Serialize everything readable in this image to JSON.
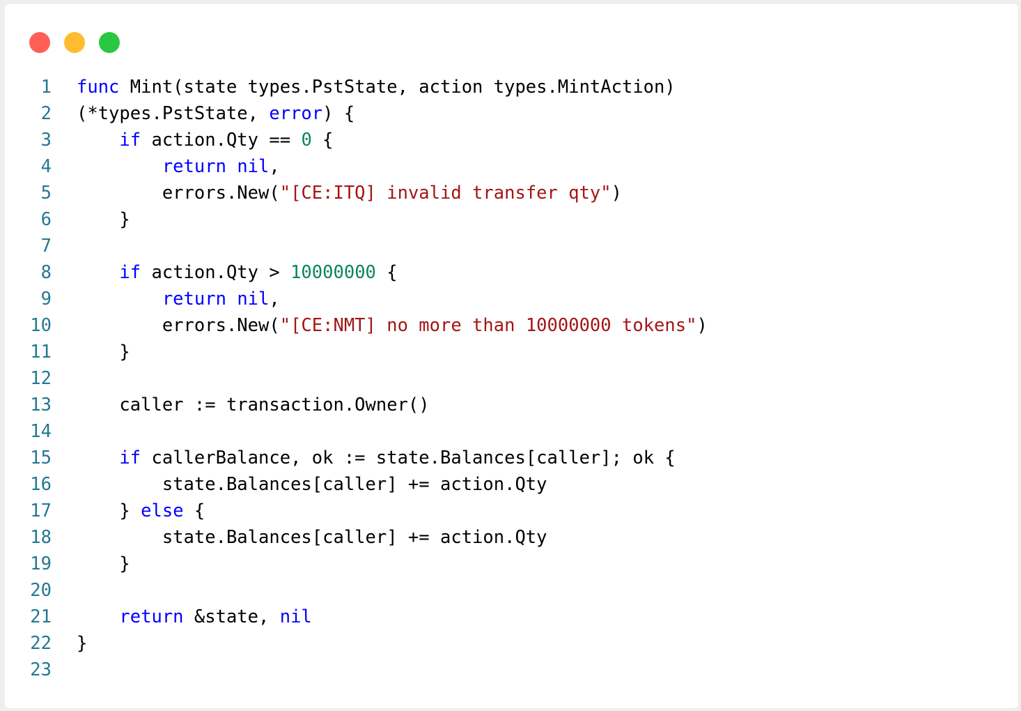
{
  "window": {
    "controls": [
      {
        "name": "close",
        "color": "#ff5f57"
      },
      {
        "name": "minimize",
        "color": "#febc2e"
      },
      {
        "name": "maximize",
        "color": "#28c840"
      }
    ]
  },
  "code": {
    "colors": {
      "line_number": "#237893",
      "keyword": "#0000ff",
      "number": "#098658",
      "string": "#a31515",
      "plain": "#000000"
    },
    "lines": [
      {
        "n": "1",
        "indent": "",
        "tokens": [
          {
            "t": "func",
            "k": "keyword"
          },
          {
            "t": " Mint(state types.PstState, action types.MintAction)",
            "k": "plain"
          }
        ]
      },
      {
        "n": "2",
        "indent": "",
        "tokens": [
          {
            "t": "(*types.PstState, ",
            "k": "plain"
          },
          {
            "t": "error",
            "k": "keyword"
          },
          {
            "t": ") {",
            "k": "plain"
          }
        ]
      },
      {
        "n": "3",
        "indent": "    ",
        "tokens": [
          {
            "t": "if",
            "k": "keyword"
          },
          {
            "t": " action.Qty == ",
            "k": "plain"
          },
          {
            "t": "0",
            "k": "number"
          },
          {
            "t": " {",
            "k": "plain"
          }
        ]
      },
      {
        "n": "4",
        "indent": "        ",
        "tokens": [
          {
            "t": "return",
            "k": "keyword"
          },
          {
            "t": " ",
            "k": "plain"
          },
          {
            "t": "nil",
            "k": "keyword"
          },
          {
            "t": ",",
            "k": "plain"
          }
        ]
      },
      {
        "n": "5",
        "indent": "        ",
        "tokens": [
          {
            "t": "errors.New(",
            "k": "plain"
          },
          {
            "t": "\"[CE:ITQ] invalid transfer qty\"",
            "k": "string"
          },
          {
            "t": ")",
            "k": "plain"
          }
        ]
      },
      {
        "n": "6",
        "indent": "    ",
        "tokens": [
          {
            "t": "}",
            "k": "plain"
          }
        ]
      },
      {
        "n": "7",
        "indent": "",
        "tokens": []
      },
      {
        "n": "8",
        "indent": "    ",
        "tokens": [
          {
            "t": "if",
            "k": "keyword"
          },
          {
            "t": " action.Qty > ",
            "k": "plain"
          },
          {
            "t": "10000000",
            "k": "number"
          },
          {
            "t": " {",
            "k": "plain"
          }
        ]
      },
      {
        "n": "9",
        "indent": "        ",
        "tokens": [
          {
            "t": "return",
            "k": "keyword"
          },
          {
            "t": " ",
            "k": "plain"
          },
          {
            "t": "nil",
            "k": "keyword"
          },
          {
            "t": ",",
            "k": "plain"
          }
        ]
      },
      {
        "n": "10",
        "indent": "        ",
        "tokens": [
          {
            "t": "errors.New(",
            "k": "plain"
          },
          {
            "t": "\"[CE:NMT] no more than 10000000 tokens\"",
            "k": "string"
          },
          {
            "t": ")",
            "k": "plain"
          }
        ]
      },
      {
        "n": "11",
        "indent": "    ",
        "tokens": [
          {
            "t": "}",
            "k": "plain"
          }
        ]
      },
      {
        "n": "12",
        "indent": "",
        "tokens": []
      },
      {
        "n": "13",
        "indent": "    ",
        "tokens": [
          {
            "t": "caller := transaction.Owner()",
            "k": "plain"
          }
        ]
      },
      {
        "n": "14",
        "indent": "",
        "tokens": []
      },
      {
        "n": "15",
        "indent": "    ",
        "tokens": [
          {
            "t": "if",
            "k": "keyword"
          },
          {
            "t": " callerBalance, ok := state.Balances[caller]; ok {",
            "k": "plain"
          }
        ]
      },
      {
        "n": "16",
        "indent": "        ",
        "tokens": [
          {
            "t": "state.Balances[caller] += action.Qty",
            "k": "plain"
          }
        ]
      },
      {
        "n": "17",
        "indent": "    ",
        "tokens": [
          {
            "t": "} ",
            "k": "plain"
          },
          {
            "t": "else",
            "k": "keyword"
          },
          {
            "t": " {",
            "k": "plain"
          }
        ]
      },
      {
        "n": "18",
        "indent": "        ",
        "tokens": [
          {
            "t": "state.Balances[caller] += action.Qty",
            "k": "plain"
          }
        ]
      },
      {
        "n": "19",
        "indent": "    ",
        "tokens": [
          {
            "t": "}",
            "k": "plain"
          }
        ]
      },
      {
        "n": "20",
        "indent": "",
        "tokens": []
      },
      {
        "n": "21",
        "indent": "    ",
        "tokens": [
          {
            "t": "return",
            "k": "keyword"
          },
          {
            "t": " &state, ",
            "k": "plain"
          },
          {
            "t": "nil",
            "k": "keyword"
          }
        ]
      },
      {
        "n": "22",
        "indent": "",
        "tokens": [
          {
            "t": "}",
            "k": "plain"
          }
        ]
      },
      {
        "n": "23",
        "indent": "",
        "tokens": []
      }
    ]
  }
}
